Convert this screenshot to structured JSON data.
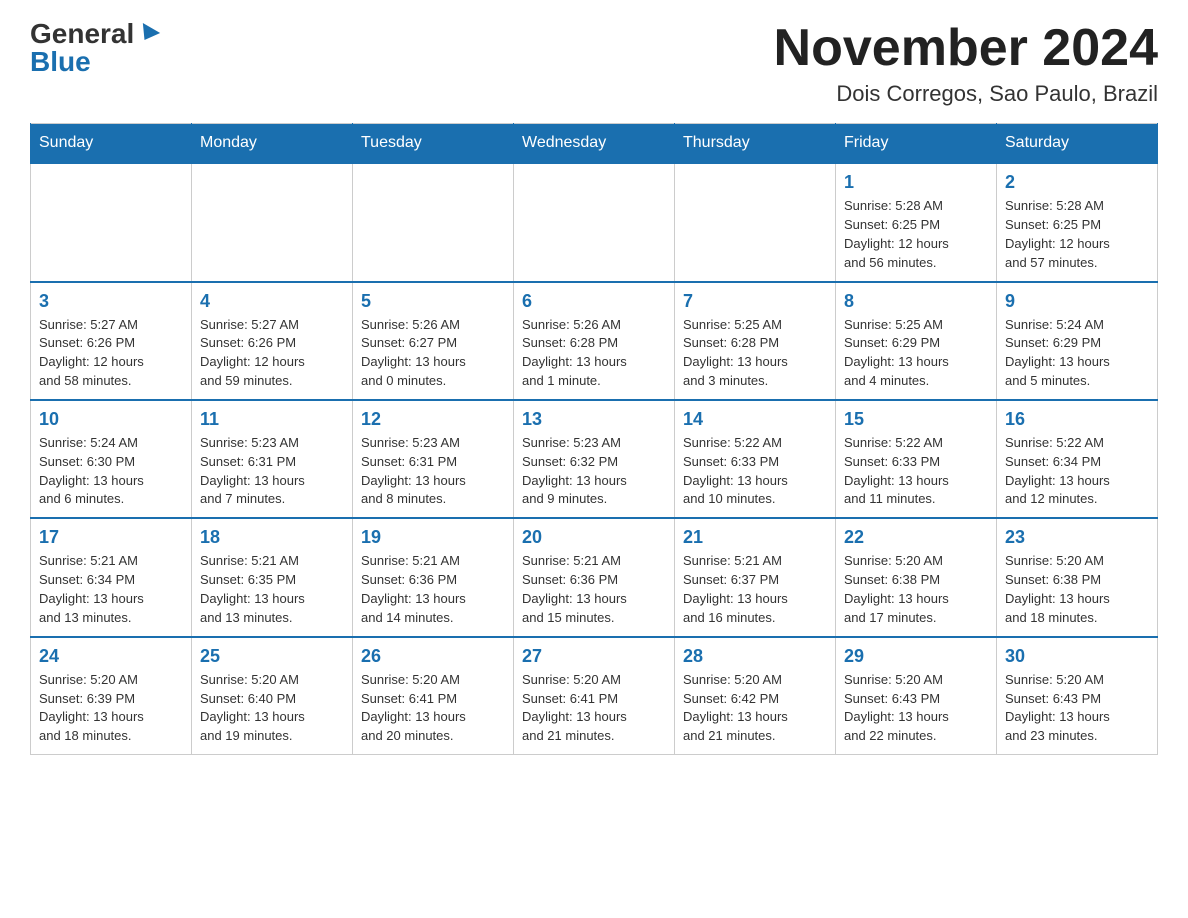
{
  "header": {
    "logo_general": "General",
    "logo_blue": "Blue",
    "month_year": "November 2024",
    "location": "Dois Corregos, Sao Paulo, Brazil"
  },
  "weekdays": [
    "Sunday",
    "Monday",
    "Tuesday",
    "Wednesday",
    "Thursday",
    "Friday",
    "Saturday"
  ],
  "weeks": [
    [
      {
        "day": "",
        "info": ""
      },
      {
        "day": "",
        "info": ""
      },
      {
        "day": "",
        "info": ""
      },
      {
        "day": "",
        "info": ""
      },
      {
        "day": "",
        "info": ""
      },
      {
        "day": "1",
        "info": "Sunrise: 5:28 AM\nSunset: 6:25 PM\nDaylight: 12 hours\nand 56 minutes."
      },
      {
        "day": "2",
        "info": "Sunrise: 5:28 AM\nSunset: 6:25 PM\nDaylight: 12 hours\nand 57 minutes."
      }
    ],
    [
      {
        "day": "3",
        "info": "Sunrise: 5:27 AM\nSunset: 6:26 PM\nDaylight: 12 hours\nand 58 minutes."
      },
      {
        "day": "4",
        "info": "Sunrise: 5:27 AM\nSunset: 6:26 PM\nDaylight: 12 hours\nand 59 minutes."
      },
      {
        "day": "5",
        "info": "Sunrise: 5:26 AM\nSunset: 6:27 PM\nDaylight: 13 hours\nand 0 minutes."
      },
      {
        "day": "6",
        "info": "Sunrise: 5:26 AM\nSunset: 6:28 PM\nDaylight: 13 hours\nand 1 minute."
      },
      {
        "day": "7",
        "info": "Sunrise: 5:25 AM\nSunset: 6:28 PM\nDaylight: 13 hours\nand 3 minutes."
      },
      {
        "day": "8",
        "info": "Sunrise: 5:25 AM\nSunset: 6:29 PM\nDaylight: 13 hours\nand 4 minutes."
      },
      {
        "day": "9",
        "info": "Sunrise: 5:24 AM\nSunset: 6:29 PM\nDaylight: 13 hours\nand 5 minutes."
      }
    ],
    [
      {
        "day": "10",
        "info": "Sunrise: 5:24 AM\nSunset: 6:30 PM\nDaylight: 13 hours\nand 6 minutes."
      },
      {
        "day": "11",
        "info": "Sunrise: 5:23 AM\nSunset: 6:31 PM\nDaylight: 13 hours\nand 7 minutes."
      },
      {
        "day": "12",
        "info": "Sunrise: 5:23 AM\nSunset: 6:31 PM\nDaylight: 13 hours\nand 8 minutes."
      },
      {
        "day": "13",
        "info": "Sunrise: 5:23 AM\nSunset: 6:32 PM\nDaylight: 13 hours\nand 9 minutes."
      },
      {
        "day": "14",
        "info": "Sunrise: 5:22 AM\nSunset: 6:33 PM\nDaylight: 13 hours\nand 10 minutes."
      },
      {
        "day": "15",
        "info": "Sunrise: 5:22 AM\nSunset: 6:33 PM\nDaylight: 13 hours\nand 11 minutes."
      },
      {
        "day": "16",
        "info": "Sunrise: 5:22 AM\nSunset: 6:34 PM\nDaylight: 13 hours\nand 12 minutes."
      }
    ],
    [
      {
        "day": "17",
        "info": "Sunrise: 5:21 AM\nSunset: 6:34 PM\nDaylight: 13 hours\nand 13 minutes."
      },
      {
        "day": "18",
        "info": "Sunrise: 5:21 AM\nSunset: 6:35 PM\nDaylight: 13 hours\nand 13 minutes."
      },
      {
        "day": "19",
        "info": "Sunrise: 5:21 AM\nSunset: 6:36 PM\nDaylight: 13 hours\nand 14 minutes."
      },
      {
        "day": "20",
        "info": "Sunrise: 5:21 AM\nSunset: 6:36 PM\nDaylight: 13 hours\nand 15 minutes."
      },
      {
        "day": "21",
        "info": "Sunrise: 5:21 AM\nSunset: 6:37 PM\nDaylight: 13 hours\nand 16 minutes."
      },
      {
        "day": "22",
        "info": "Sunrise: 5:20 AM\nSunset: 6:38 PM\nDaylight: 13 hours\nand 17 minutes."
      },
      {
        "day": "23",
        "info": "Sunrise: 5:20 AM\nSunset: 6:38 PM\nDaylight: 13 hours\nand 18 minutes."
      }
    ],
    [
      {
        "day": "24",
        "info": "Sunrise: 5:20 AM\nSunset: 6:39 PM\nDaylight: 13 hours\nand 18 minutes."
      },
      {
        "day": "25",
        "info": "Sunrise: 5:20 AM\nSunset: 6:40 PM\nDaylight: 13 hours\nand 19 minutes."
      },
      {
        "day": "26",
        "info": "Sunrise: 5:20 AM\nSunset: 6:41 PM\nDaylight: 13 hours\nand 20 minutes."
      },
      {
        "day": "27",
        "info": "Sunrise: 5:20 AM\nSunset: 6:41 PM\nDaylight: 13 hours\nand 21 minutes."
      },
      {
        "day": "28",
        "info": "Sunrise: 5:20 AM\nSunset: 6:42 PM\nDaylight: 13 hours\nand 21 minutes."
      },
      {
        "day": "29",
        "info": "Sunrise: 5:20 AM\nSunset: 6:43 PM\nDaylight: 13 hours\nand 22 minutes."
      },
      {
        "day": "30",
        "info": "Sunrise: 5:20 AM\nSunset: 6:43 PM\nDaylight: 13 hours\nand 23 minutes."
      }
    ]
  ]
}
